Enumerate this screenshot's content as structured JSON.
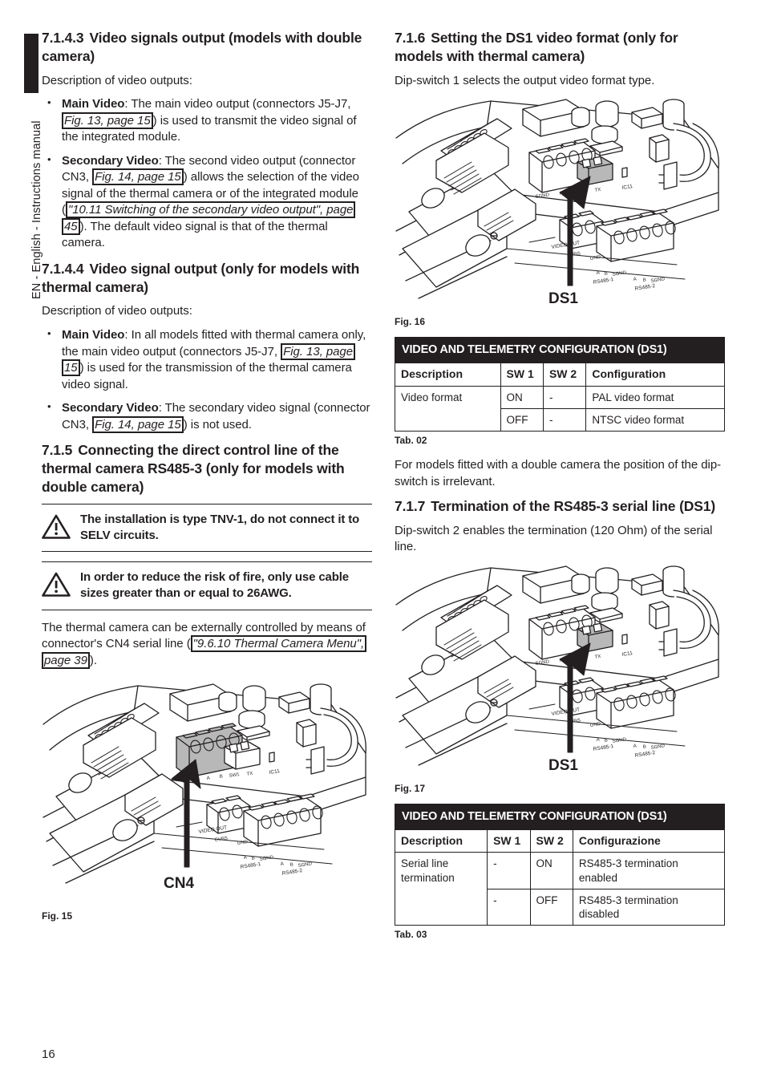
{
  "side_tab": {
    "text": "EN - English - Instructions manual"
  },
  "page_number": "16",
  "left_column": {
    "section_7143": {
      "number": "7.1.4.3",
      "title": "Video signals output (models with double camera)",
      "intro": "Description of video outputs:",
      "bullets": [
        {
          "label": "Main Video",
          "t1": ": The main video output (connectors J5-J7, ",
          "xref": "Fig. 13, page 15",
          "t2": ") is used to transmit the video signal of the integrated module."
        },
        {
          "label": "Secondary Video",
          "t1": ": The second video output (connector CN3, ",
          "xref": "Fig. 14, page 15",
          "t2": ") allows the selection of the video signal of the thermal camera or of the integrated module (",
          "xref2": "\"10.11 Switching of the secondary video output\", page 45",
          "t3": "). The default video signal is that of the thermal camera."
        }
      ]
    },
    "section_7144": {
      "number": "7.1.4.4",
      "title": "Video signal output (only for models with thermal camera)",
      "intro": "Description of video outputs:",
      "bullets": [
        {
          "label": "Main Video",
          "t1": ": In all models fitted with thermal camera only, the main video output (connectors J5-J7, ",
          "xref": "Fig. 13, page 15",
          "t2": ") is used for the transmission of the thermal camera video signal."
        },
        {
          "label": "Secondary Video",
          "t1": ": The secondary video signal (connector CN3, ",
          "xref": "Fig. 14, page 15",
          "t2": ") is not used."
        }
      ]
    },
    "section_715": {
      "number": "7.1.5",
      "title": "Connecting the direct control line of the thermal camera RS485-3 (only for models with double camera)",
      "warnings": [
        "The installation is type TNV-1, do not connect it to SELV circuits.",
        "In order to reduce the risk of fire, only use cable sizes greater than or equal to 26AWG."
      ],
      "paragraph_pre": "The thermal camera can be externally controlled by means of connector's CN4 serial line (",
      "paragraph_xref": "\"9.6.10 Thermal Camera Menu\", page 39",
      "paragraph_post": ")."
    },
    "figure_15": {
      "caption": "Fig. 15",
      "callout": "CN4",
      "silk": {
        "video_out": "VIDEO OUT",
        "cvbs": "CVBS",
        "gnd": "GND",
        "rs485_1": "RS485-1",
        "rs485_2": "RS485-2",
        "pins_a": "A",
        "pins_b": "B",
        "pins_sgnd": "SGND",
        "ic11": "IC11",
        "sw1": "SW1",
        "tx": "TX"
      }
    }
  },
  "right_column": {
    "section_716": {
      "number": "7.1.6",
      "title": "Setting the DS1 video format (only for models with thermal camera)",
      "paragraph": "Dip-switch 1 selects the output video format type."
    },
    "figure_16": {
      "caption": "Fig. 16",
      "callout": "DS1"
    },
    "table_02": {
      "title": "VIDEO AND TELEMETRY CONFIGURATION (DS1)",
      "headers": [
        "Description",
        "SW 1",
        "SW 2",
        "Configuration"
      ],
      "rows": [
        [
          "Video format",
          "ON",
          "-",
          "PAL video format"
        ],
        [
          "",
          "OFF",
          "-",
          "NTSC video format"
        ]
      ],
      "caption": "Tab. 02"
    },
    "paragraph_after_tab02": "For models fitted with a double camera the position of the dip-switch is irrelevant.",
    "section_717": {
      "number": "7.1.7",
      "title": "Termination of the RS485-3 serial line (DS1)",
      "paragraph": "Dip-switch 2 enables the termination (120 Ohm) of the serial line."
    },
    "figure_17": {
      "caption": "Fig. 17",
      "callout": "DS1"
    },
    "table_03": {
      "title": "VIDEO AND TELEMETRY CONFIGURATION (DS1)",
      "headers": [
        "Description",
        "SW 1",
        "SW 2",
        "Configurazione"
      ],
      "rows": [
        [
          "Serial line termination",
          "-",
          "ON",
          "RS485-3 termination enabled"
        ],
        [
          "",
          "-",
          "OFF",
          "RS485-3 termination disabled"
        ]
      ],
      "caption": "Tab. 03"
    }
  }
}
